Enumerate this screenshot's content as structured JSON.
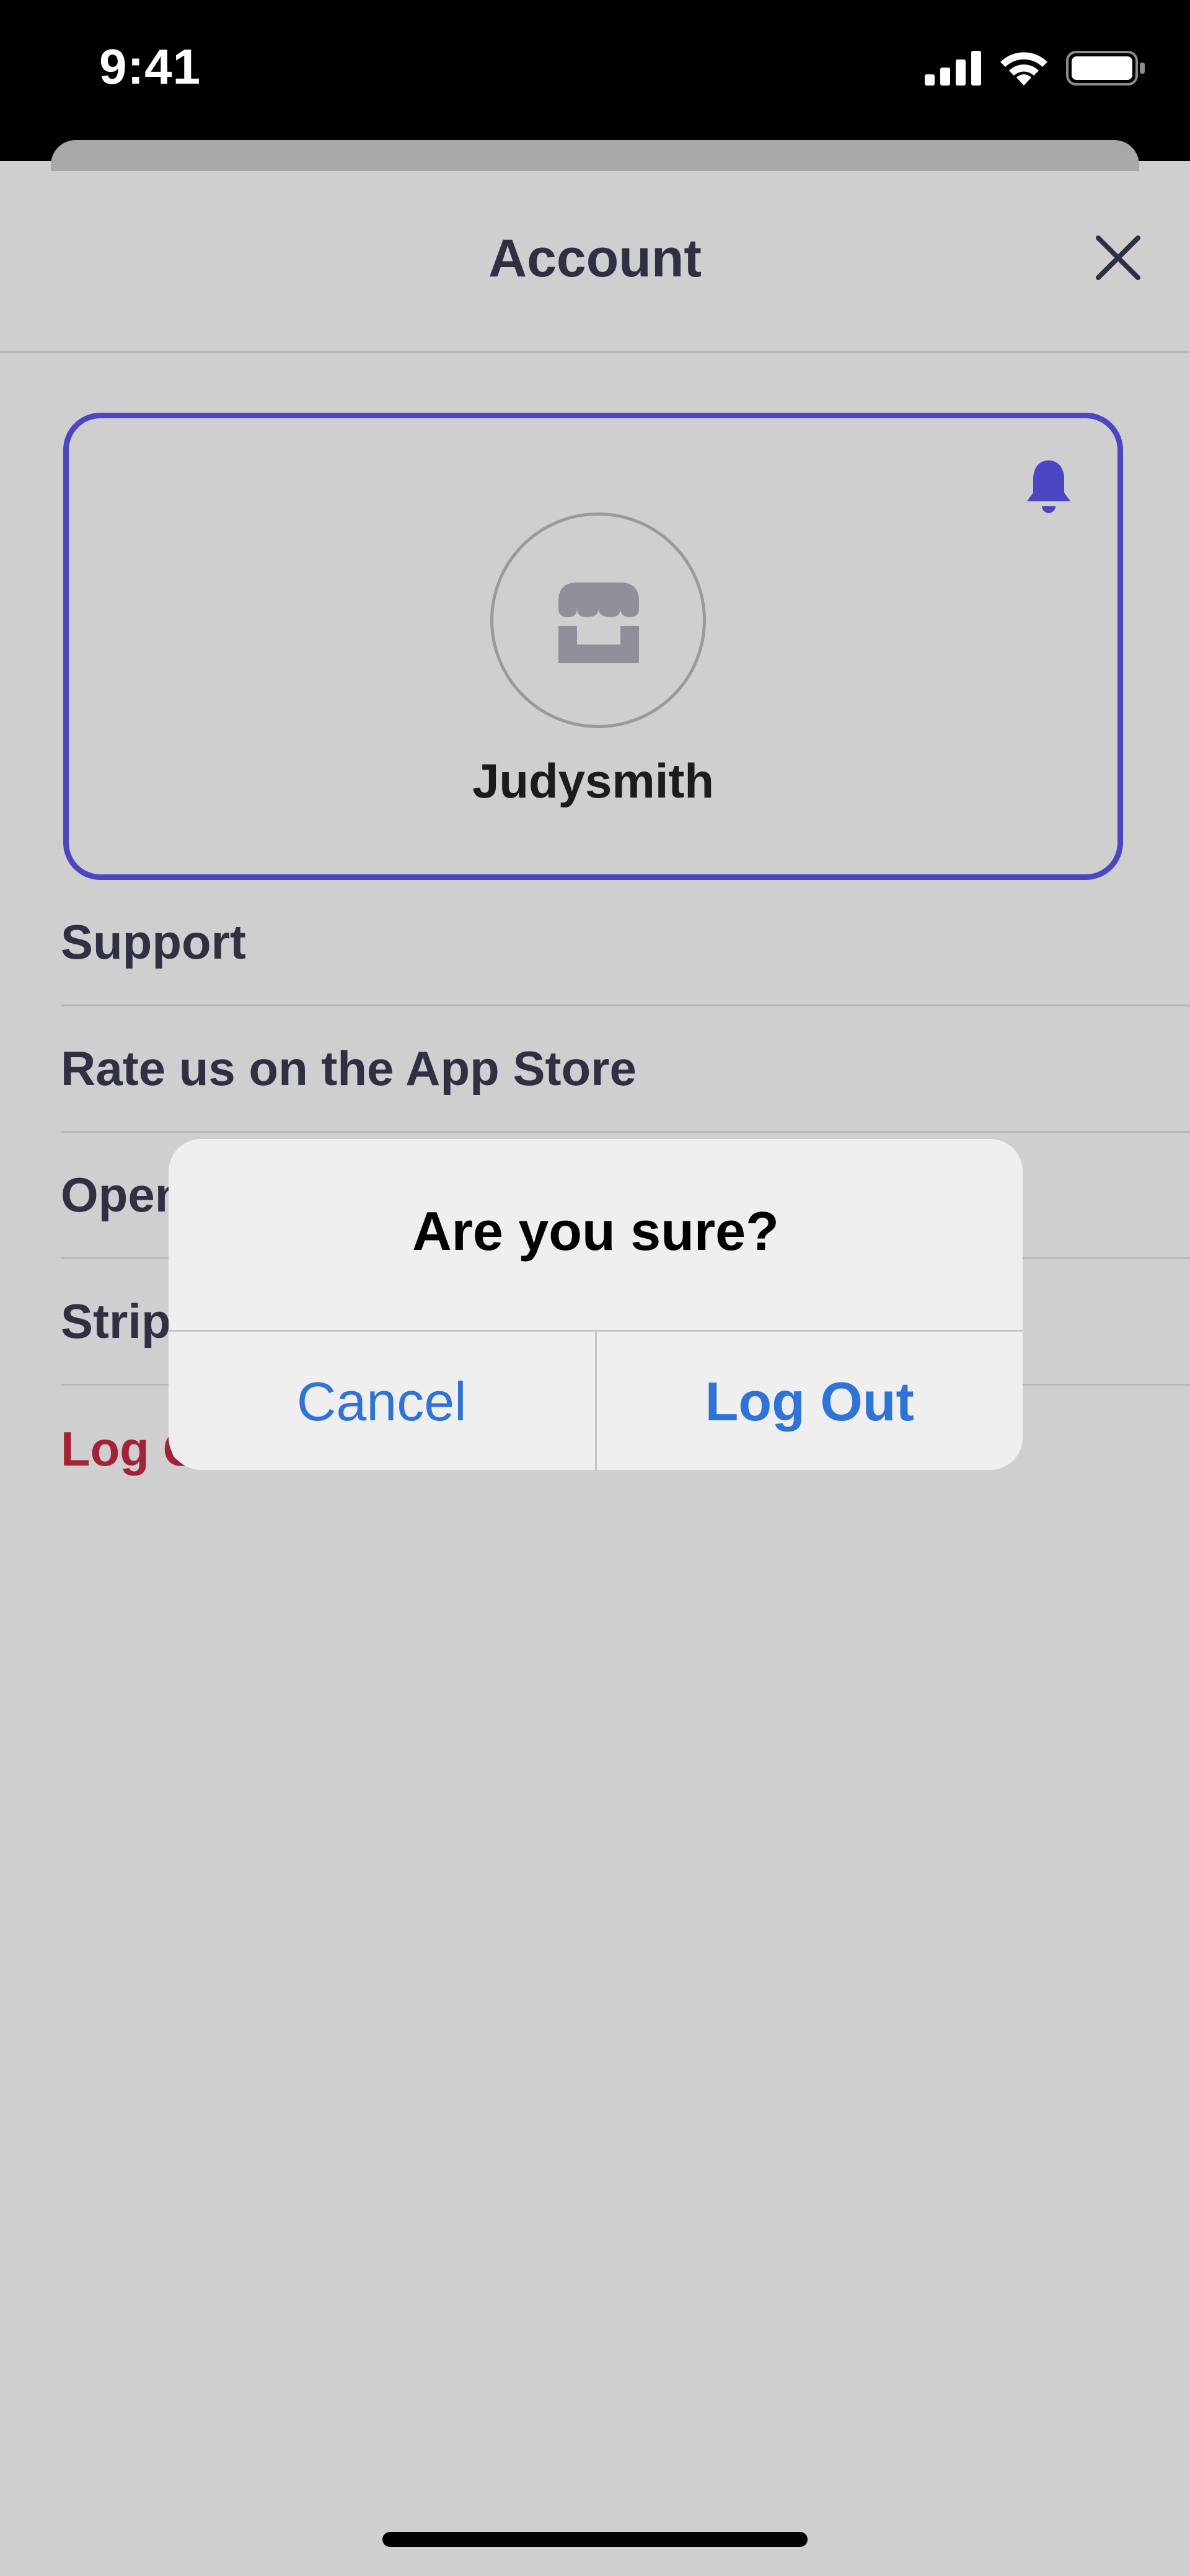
{
  "status_bar": {
    "time": "9:41"
  },
  "sheet": {
    "title": "Account"
  },
  "profile": {
    "username": "Judysmith"
  },
  "menu": {
    "items": [
      {
        "label": "Support"
      },
      {
        "label": "Rate us on the App Store"
      },
      {
        "label": "Open"
      },
      {
        "label": "Strip"
      },
      {
        "label": "Log Out"
      }
    ]
  },
  "alert": {
    "title": "Are you sure?",
    "cancel_label": "Cancel",
    "confirm_label": "Log Out"
  },
  "colors": {
    "accent": "#4b46c2",
    "destructive": "#a32336",
    "link_blue": "#2f73d9",
    "text_primary": "#2e3143"
  },
  "icons": [
    "signal-icon",
    "wifi-icon",
    "battery-icon",
    "close-icon",
    "bell-icon",
    "shop-icon"
  ]
}
